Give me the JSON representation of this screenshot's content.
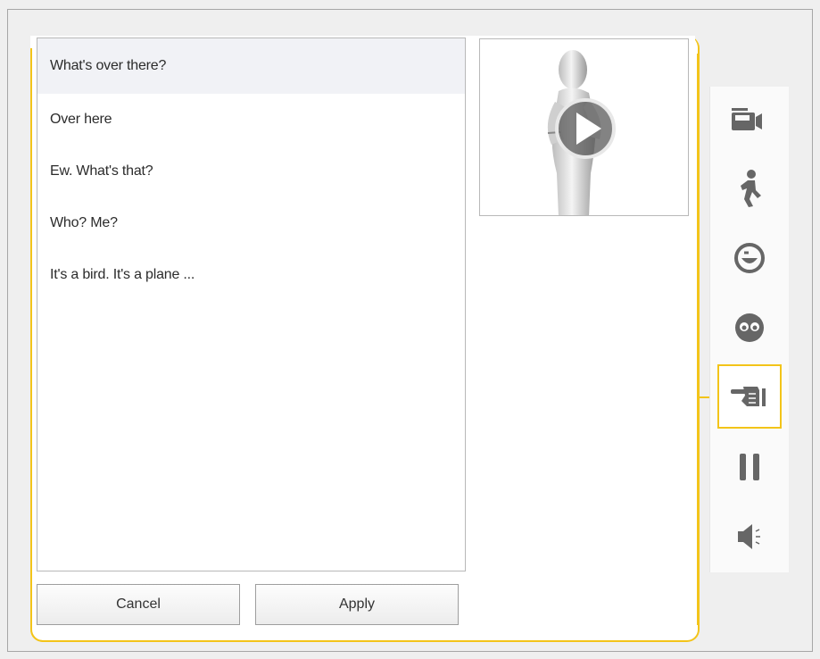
{
  "list": {
    "items": [
      {
        "label": "What's over there?",
        "selected": true
      },
      {
        "label": "Over here"
      },
      {
        "label": "Ew. What's that?"
      },
      {
        "label": "Who? Me?"
      },
      {
        "label": "It's a bird. It's a plane ..."
      }
    ]
  },
  "buttons": {
    "cancel_label": "Cancel",
    "apply_label": "Apply"
  },
  "preview": {
    "icon": "play-icon"
  },
  "toolbar": {
    "tools": [
      {
        "name": "camera-icon"
      },
      {
        "name": "walk-icon"
      },
      {
        "name": "smile-face-icon"
      },
      {
        "name": "eyes-face-icon"
      },
      {
        "name": "pointing-hand-icon",
        "active": true
      },
      {
        "name": "pause-icon"
      },
      {
        "name": "speaker-icon"
      }
    ]
  },
  "colors": {
    "accent": "#f3c419",
    "icon": "#666666"
  }
}
